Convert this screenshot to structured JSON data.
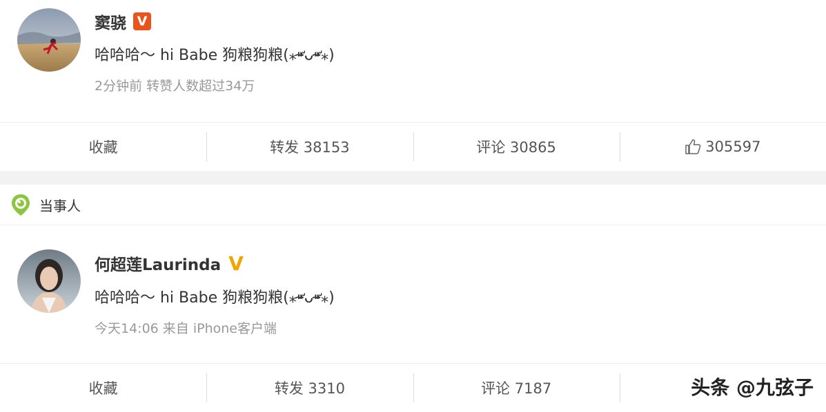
{
  "post1": {
    "author": "窦骁",
    "verified": "V",
    "text": "哈哈哈～ hi Babe 狗粮狗粮(⁎⁍̴̛ᴗ⁍̴̛⁎)",
    "meta": "2分钟前 转赞人数超过34万",
    "actions": {
      "favorite": "收藏",
      "repost": "转发 38153",
      "comment": "评论 30865",
      "like": "305597"
    }
  },
  "tag": {
    "label": "当事人"
  },
  "post2": {
    "author": "何超莲Laurinda",
    "verified": "V",
    "text": "哈哈哈～ hi Babe 狗粮狗粮(⁎⁍̴̛ᴗ⁍̴̛⁎)",
    "meta": "今天14:06 来自 iPhone客户端",
    "actions": {
      "favorite": "收藏",
      "repost": "转发 3310",
      "comment": "评论 7187",
      "like": ""
    }
  },
  "watermark": "头条 @九弦子",
  "colors": {
    "verified_red": "#e8541b",
    "verified_gold": "#f0a500",
    "tag_green": "#8cc63f"
  },
  "icons": [
    "thumbs-up-icon",
    "location-tag-icon"
  ]
}
